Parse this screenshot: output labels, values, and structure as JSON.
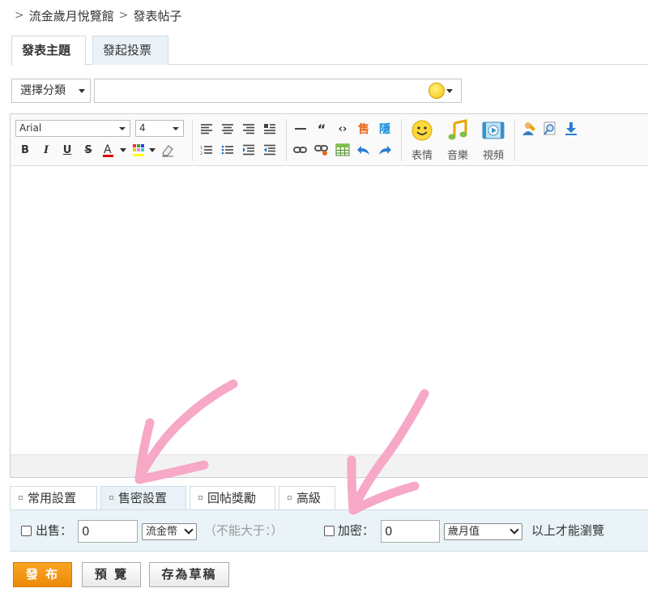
{
  "breadcrumb": {
    "items": [
      "流金歲月悅覽館",
      "發表帖子"
    ],
    "separator": ">"
  },
  "tabs": [
    {
      "label": "發表主題",
      "active": true
    },
    {
      "label": "發起投票",
      "active": false
    }
  ],
  "category": {
    "label": "選擇分類"
  },
  "subject": {
    "value": "",
    "placeholder": ""
  },
  "toolbar": {
    "font_family": "Arial",
    "font_size": "4",
    "emoticons_label": "表情",
    "music_label": "音樂",
    "video_label": "視頻",
    "sell_icon_label": "售",
    "hide_icon_label": "隱"
  },
  "sub_tabs": [
    {
      "label": "常用設置",
      "active": false
    },
    {
      "label": "售密設置",
      "active": true
    },
    {
      "label": "回帖獎勵",
      "active": false
    },
    {
      "label": "高級",
      "active": false
    }
  ],
  "options": {
    "sell_label": "出售：",
    "sell_value": "0",
    "sell_currency": "流金幣",
    "sell_hint": "（不能大于：）",
    "encrypt_label": "加密：",
    "encrypt_value": "0",
    "encrypt_currency": "歲月值",
    "encrypt_hint": "以上才能瀏覽"
  },
  "buttons": {
    "submit": "發 布",
    "preview": "預 覽",
    "draft": "存為草稿"
  },
  "colors": {
    "accent": "#ec8a09",
    "annotation": "#f6a8c6",
    "options_bg": "#eaf4f8"
  }
}
